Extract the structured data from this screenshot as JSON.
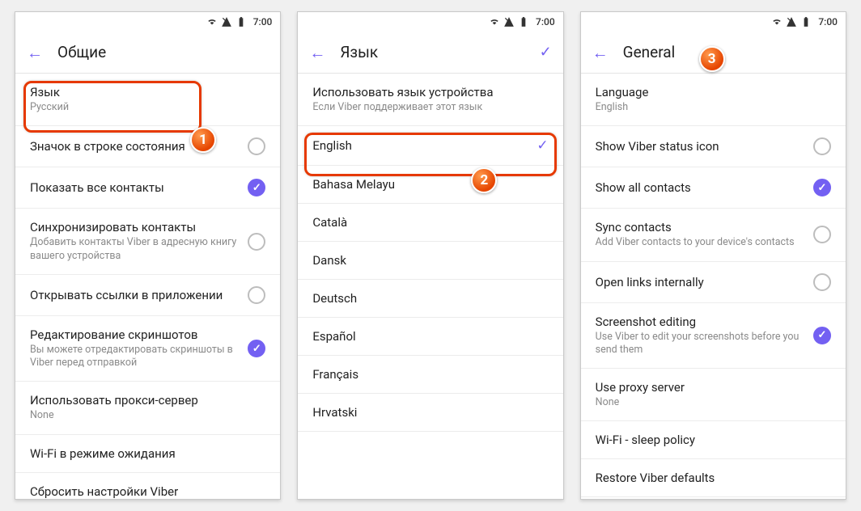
{
  "status": {
    "time": "7:00"
  },
  "panel1": {
    "title": "Общие",
    "callout_num": "1",
    "items": [
      {
        "label": "Язык",
        "sub": "Русский",
        "toggle": null
      },
      {
        "label": "Значок в строке состояния",
        "sub": "",
        "toggle": "off"
      },
      {
        "label": "Показать все контакты",
        "sub": "",
        "toggle": "on"
      },
      {
        "label": "Синхронизировать контакты",
        "sub": "Добавить контакты Viber в адресную книгу вашего устройства",
        "toggle": "off"
      },
      {
        "label": "Открывать ссылки в приложении",
        "sub": "",
        "toggle": "off"
      },
      {
        "label": "Редактирование скриншотов",
        "sub": "Вы можете отредактировать скриншоты в Viber перед отправкой",
        "toggle": "on"
      },
      {
        "label": "Использовать прокси-сервер",
        "sub": "None",
        "toggle": null
      },
      {
        "label": "Wi-Fi в режиме ожидания",
        "sub": "",
        "toggle": null
      },
      {
        "label": "Сбросить настройки Viber",
        "sub": "",
        "toggle": null
      }
    ]
  },
  "panel2": {
    "title": "Язык",
    "callout_num": "2",
    "header_item": {
      "label": "Использовать язык устройства",
      "sub": "Если Viber поддерживает этот язык"
    },
    "items": [
      {
        "label": "English",
        "selected": true
      },
      {
        "label": "Bahasa Melayu",
        "selected": false
      },
      {
        "label": "Català",
        "selected": false
      },
      {
        "label": "Dansk",
        "selected": false
      },
      {
        "label": "Deutsch",
        "selected": false
      },
      {
        "label": "Español",
        "selected": false
      },
      {
        "label": "Français",
        "selected": false
      },
      {
        "label": "Hrvatski",
        "selected": false
      }
    ]
  },
  "panel3": {
    "title": "General",
    "callout_num": "3",
    "items": [
      {
        "label": "Language",
        "sub": "English",
        "toggle": null
      },
      {
        "label": "Show Viber status icon",
        "sub": "",
        "toggle": "off"
      },
      {
        "label": "Show all contacts",
        "sub": "",
        "toggle": "on"
      },
      {
        "label": "Sync contacts",
        "sub": "Add Viber contacts to your device's contacts",
        "toggle": "off"
      },
      {
        "label": "Open links internally",
        "sub": "",
        "toggle": "off"
      },
      {
        "label": "Screenshot editing",
        "sub": "Use Viber to edit your screenshots before you send them",
        "toggle": "on"
      },
      {
        "label": "Use proxy server",
        "sub": "None",
        "toggle": null
      },
      {
        "label": "Wi-Fi - sleep policy",
        "sub": "",
        "toggle": null
      },
      {
        "label": "Restore Viber defaults",
        "sub": "",
        "toggle": null
      }
    ]
  }
}
